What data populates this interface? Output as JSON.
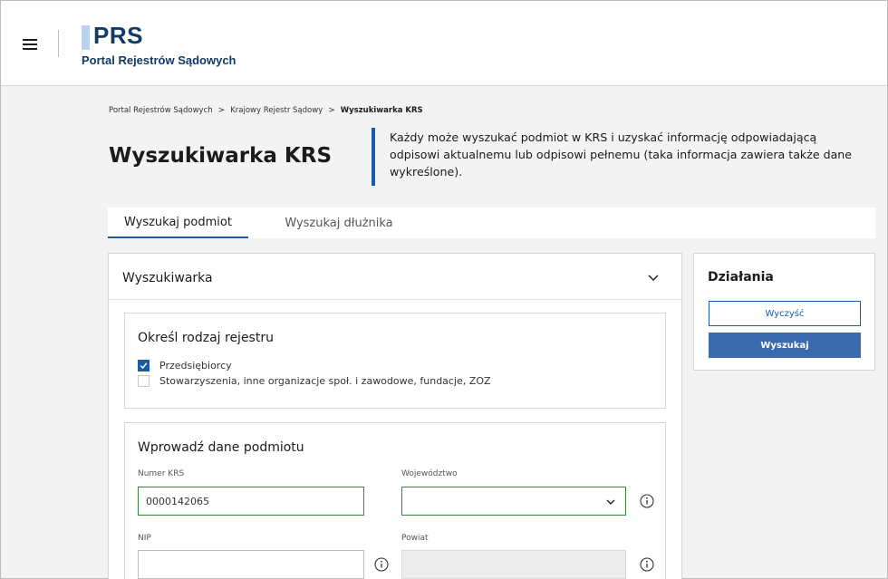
{
  "header": {
    "logo_title": "PRS",
    "logo_subtitle": "Portal Rejestrów Sądowych"
  },
  "breadcrumb": {
    "items": [
      "Portal Rejestrów Sądowych",
      "Krajowy Rejestr Sądowy"
    ],
    "current": "Wyszukiwarka KRS",
    "separator": ">"
  },
  "page": {
    "title": "Wyszukiwarka KRS",
    "description": "Każdy może wyszukać podmiot w KRS i uzyskać informację odpowiadającą odpisowi aktualnemu lub odpisowi pełnemu (taka informacja zawiera także dane wykreślone)."
  },
  "tabs": [
    {
      "label": "Wyszukaj podmiot",
      "active": true
    },
    {
      "label": "Wyszukaj dłużnika",
      "active": false
    }
  ],
  "search_card": {
    "title": "Wyszukiwarka",
    "registry": {
      "title": "Określ rodzaj rejestru",
      "options": [
        {
          "label": "Przedsiębiorcy",
          "checked": true
        },
        {
          "label": "Stowarzyszenia, inne organizacje społ. i zawodowe, fundacje, ZOZ",
          "checked": false
        }
      ]
    },
    "entity": {
      "title": "Wprowadź dane podmiotu",
      "krs_label": "Numer KRS",
      "krs_value": "0000142065",
      "voivodeship_label": "Województwo",
      "voivodeship_value": "",
      "nip_label": "NIP",
      "nip_value": "",
      "county_label": "Powiat",
      "county_value": ""
    }
  },
  "actions": {
    "title": "Działania",
    "clear_label": "Wyczyść",
    "search_label": "Wyszukaj"
  },
  "colors": {
    "brand_dark": "#123a66",
    "accent": "#1e5aa0",
    "primary_button": "#3b6aad",
    "valid_border": "#3b8a3b"
  }
}
